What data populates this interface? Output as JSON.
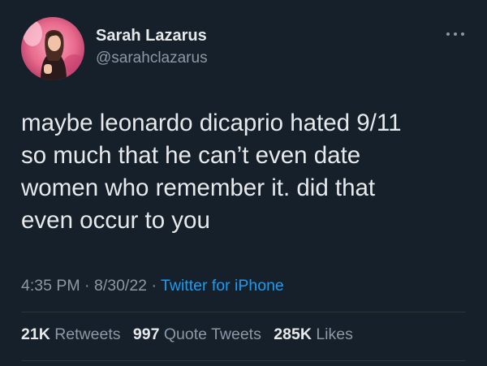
{
  "author": {
    "name": "Sarah Lazarus",
    "handle": "@sarahclazarus"
  },
  "tweet": {
    "lines": [
      "maybe leonardo dicaprio hated 9/11",
      "so much that he can’t even date",
      "women who remember it. did that",
      "even occur to you"
    ]
  },
  "meta": {
    "time": "4:35 PM",
    "separator": "·",
    "date": "8/30/22",
    "source": "Twitter for iPhone"
  },
  "stats": {
    "retweets_count": "21K",
    "retweets_label": "Retweets",
    "quotes_count": "997",
    "quotes_label": "Quote Tweets",
    "likes_count": "285K",
    "likes_label": "Likes"
  },
  "icons": {
    "more": "more-horizontal-icon",
    "avatar": "profile-photo"
  },
  "colors": {
    "background": "#15202b",
    "text_primary": "#e7e9ea",
    "text_secondary": "#8b98a5",
    "accent": "#1d9bf0",
    "divider": "#2f3336"
  }
}
